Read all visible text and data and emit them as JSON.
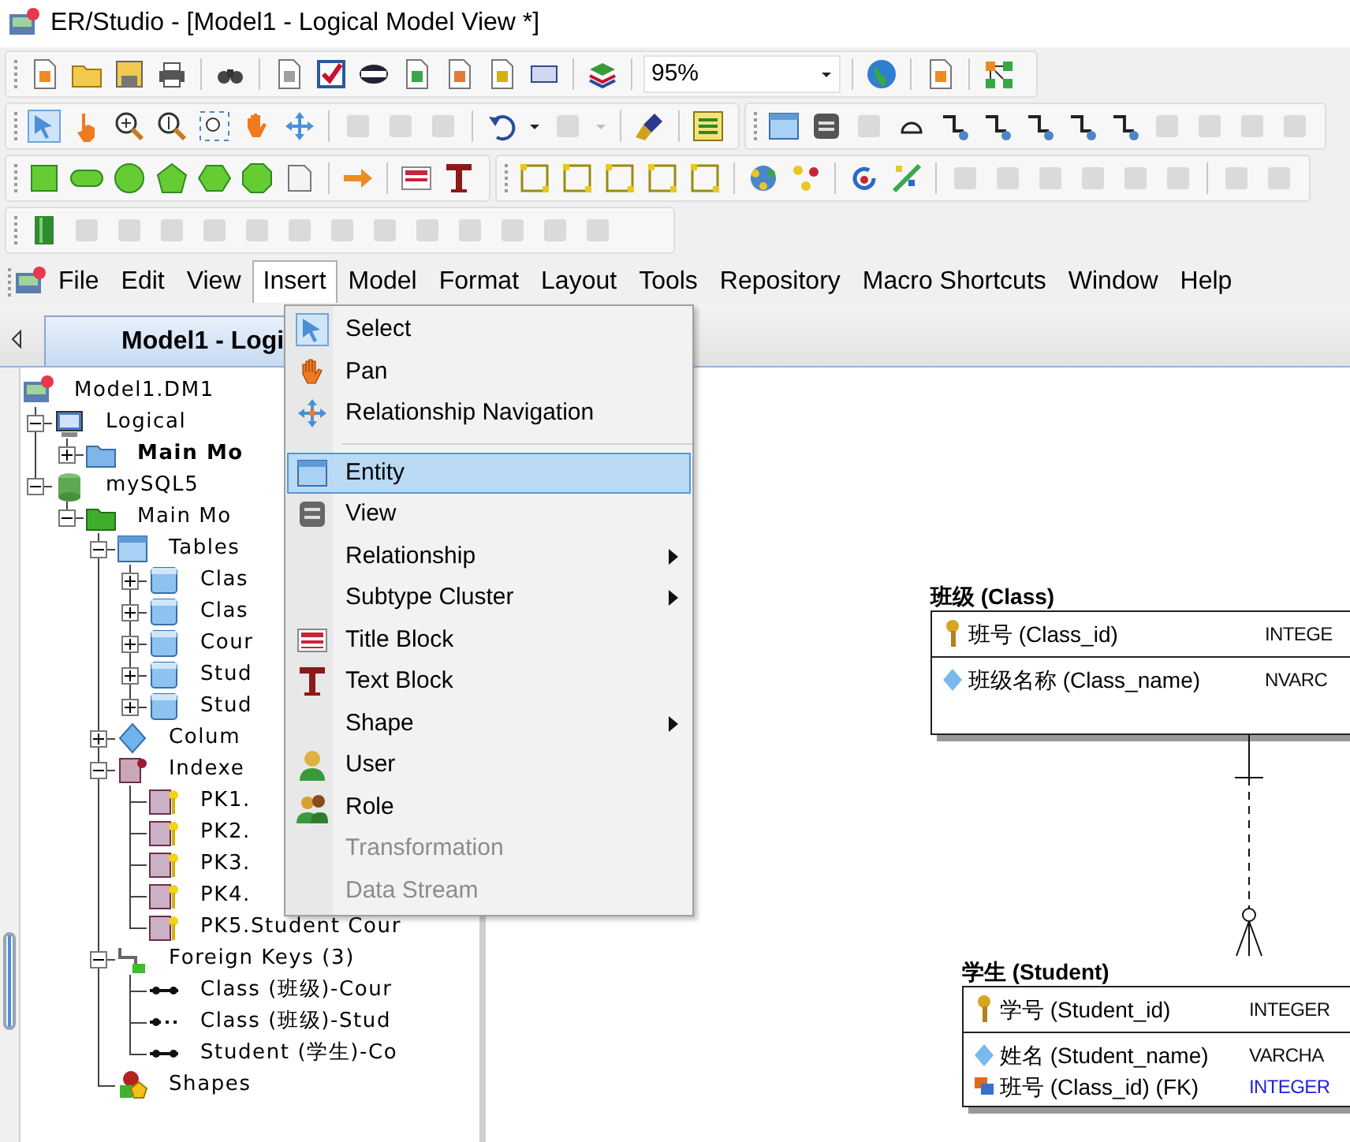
{
  "window": {
    "title": "ER/Studio - [Model1 - Logical Model View *]"
  },
  "toolbar": {
    "zoom_value": "95%"
  },
  "menu_bar": [
    {
      "label": "File",
      "selected": false
    },
    {
      "label": "Edit",
      "selected": false
    },
    {
      "label": "View",
      "selected": false
    },
    {
      "label": "Insert",
      "selected": true
    },
    {
      "label": "Model",
      "selected": false
    },
    {
      "label": "Format",
      "selected": false
    },
    {
      "label": "Layout",
      "selected": false
    },
    {
      "label": "Tools",
      "selected": false
    },
    {
      "label": "Repository",
      "selected": false
    },
    {
      "label": "Macro Shortcuts",
      "selected": false
    },
    {
      "label": "Window",
      "selected": false
    },
    {
      "label": "Help",
      "selected": false
    }
  ],
  "tab": {
    "label": "Model1 - Logi",
    "selected": true
  },
  "tree": [
    {
      "label": "Model1.DM1",
      "kind": "model",
      "bold": false,
      "children": [
        {
          "label": "Logical",
          "kind": "logical",
          "bold": false,
          "expanded": true,
          "children": [
            {
              "label": "Main Mo",
              "kind": "submodel",
              "bold": true,
              "expanded": false
            }
          ]
        },
        {
          "label": "mySQL5",
          "kind": "physical",
          "bold": false,
          "expanded": true,
          "children": [
            {
              "label": "Main Mo",
              "kind": "submodel-open",
              "bold": false,
              "expanded": true,
              "children": [
                {
                  "label": "Tables",
                  "kind": "tables",
                  "bold": false,
                  "expanded": true,
                  "children": [
                    {
                      "label": "Clas",
                      "kind": "table",
                      "bold": false,
                      "expanded": false
                    },
                    {
                      "label": "Clas",
                      "kind": "table",
                      "bold": false,
                      "expanded": false
                    },
                    {
                      "label": "Cour",
                      "kind": "table",
                      "bold": false,
                      "expanded": false
                    },
                    {
                      "label": "Stud",
                      "kind": "table",
                      "bold": false,
                      "expanded": false
                    },
                    {
                      "label": "Stud",
                      "kind": "table",
                      "bold": false,
                      "expanded": false
                    }
                  ]
                },
                {
                  "label": "Colum",
                  "kind": "columns",
                  "bold": false,
                  "expanded": false
                },
                {
                  "label": "Indexe",
                  "kind": "indexes",
                  "bold": false,
                  "expanded": true,
                  "children": [
                    {
                      "label": "PK1.",
                      "kind": "index",
                      "bold": false
                    },
                    {
                      "label": "PK2.",
                      "kind": "index",
                      "bold": false
                    },
                    {
                      "label": "PK3.",
                      "kind": "index",
                      "bold": false
                    },
                    {
                      "label": "PK4.",
                      "kind": "index",
                      "bold": false
                    },
                    {
                      "label": "PK5.Student Cour",
                      "kind": "index",
                      "bold": false
                    }
                  ]
                },
                {
                  "label": "Foreign Keys (3)",
                  "kind": "foreign-keys",
                  "bold": false,
                  "expanded": true,
                  "children": [
                    {
                      "label": "Class (班级)-Cour",
                      "kind": "fk",
                      "bold": false
                    },
                    {
                      "label": "Class (班级)-Stud",
                      "kind": "fk-optional",
                      "bold": false
                    },
                    {
                      "label": "Student (学生)-Co",
                      "kind": "fk",
                      "bold": false
                    }
                  ]
                },
                {
                  "label": "Shapes",
                  "kind": "shapes",
                  "bold": false
                }
              ]
            }
          ]
        }
      ]
    }
  ],
  "insert_menu": [
    {
      "kind": "item",
      "label": "Select",
      "selected": false,
      "disabled": false,
      "submenu": false
    },
    {
      "kind": "item",
      "label": "Pan",
      "selected": false,
      "disabled": false,
      "submenu": false
    },
    {
      "kind": "item",
      "label": "Relationship Navigation",
      "selected": false,
      "disabled": false,
      "submenu": false
    },
    {
      "kind": "separator"
    },
    {
      "kind": "item",
      "label": "Entity",
      "selected": true,
      "disabled": false,
      "submenu": false
    },
    {
      "kind": "item",
      "label": "View",
      "selected": false,
      "disabled": false,
      "submenu": false
    },
    {
      "kind": "item",
      "label": "Relationship",
      "selected": false,
      "disabled": false,
      "submenu": true
    },
    {
      "kind": "item",
      "label": "Subtype Cluster",
      "selected": false,
      "disabled": false,
      "submenu": true
    },
    {
      "kind": "item",
      "label": "Title Block",
      "selected": false,
      "disabled": false,
      "submenu": false
    },
    {
      "kind": "item",
      "label": "Text Block",
      "selected": false,
      "disabled": false,
      "submenu": false
    },
    {
      "kind": "item",
      "label": "Shape",
      "selected": false,
      "disabled": false,
      "submenu": true
    },
    {
      "kind": "item",
      "label": "User",
      "selected": false,
      "disabled": false,
      "submenu": false
    },
    {
      "kind": "item",
      "label": "Role",
      "selected": false,
      "disabled": false,
      "submenu": false
    },
    {
      "kind": "item",
      "label": "Transformation",
      "selected": false,
      "disabled": true,
      "submenu": false
    },
    {
      "kind": "item",
      "label": "Data Stream",
      "selected": false,
      "disabled": true,
      "submenu": false
    }
  ],
  "diagram": {
    "entities": [
      {
        "title": "班级 (Class)",
        "keys": [
          {
            "name": "班号 (Class_id)",
            "type": "INTEGE",
            "kind": "pk"
          }
        ],
        "attributes": [
          {
            "name": "班级名称 (Class_name)",
            "type": "NVARC",
            "kind": "attribute"
          }
        ]
      },
      {
        "title": "学生 (Student)",
        "keys": [
          {
            "name": "学号 (Student_id)",
            "type": "INTEGER",
            "kind": "pk"
          }
        ],
        "attributes": [
          {
            "name": "姓名 (Student_name)",
            "type": "VARCHA",
            "kind": "attribute"
          },
          {
            "name": "班号 (Class_id) (FK)",
            "type": "INTEGER",
            "kind": "fk"
          }
        ]
      }
    ],
    "relationships": [
      {
        "kind": "non-identifying"
      }
    ]
  }
}
